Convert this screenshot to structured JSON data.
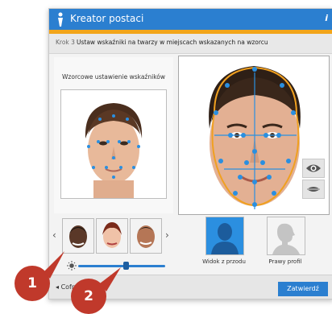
{
  "window": {
    "title": "Kreator postaci",
    "help": "i"
  },
  "steps": {
    "step_label": "Krok 3",
    "instruction": "Ustaw wskaźniki na twarzy w miejscach wskazanych na wzorcu"
  },
  "left_panel": {
    "reference_label": "Wzorcowe ustawienie wskaźników"
  },
  "thumbnails": {
    "prev_arrow": "‹",
    "next_arrow": "›",
    "items": [
      "thumbnail-1",
      "thumbnail-2",
      "thumbnail-3"
    ]
  },
  "slider": {
    "icon": "brightness-icon",
    "value_fraction": 0.55
  },
  "view_options": {
    "front_label": "Widok z przodu",
    "profile_label": "Prawy profil"
  },
  "side_buttons": [
    "eye-icon",
    "mouth-icon"
  ],
  "bottom": {
    "back_label": "Cofnij",
    "next_label": "Zatwierdź"
  },
  "annotations": {
    "badge1": "1",
    "badge2": "2"
  },
  "colors": {
    "accent": "#2b7fd0",
    "stripe": "#f2a51a",
    "contour": "#f0a020",
    "marker": "#2a8fe0",
    "badge": "#c0392b"
  }
}
